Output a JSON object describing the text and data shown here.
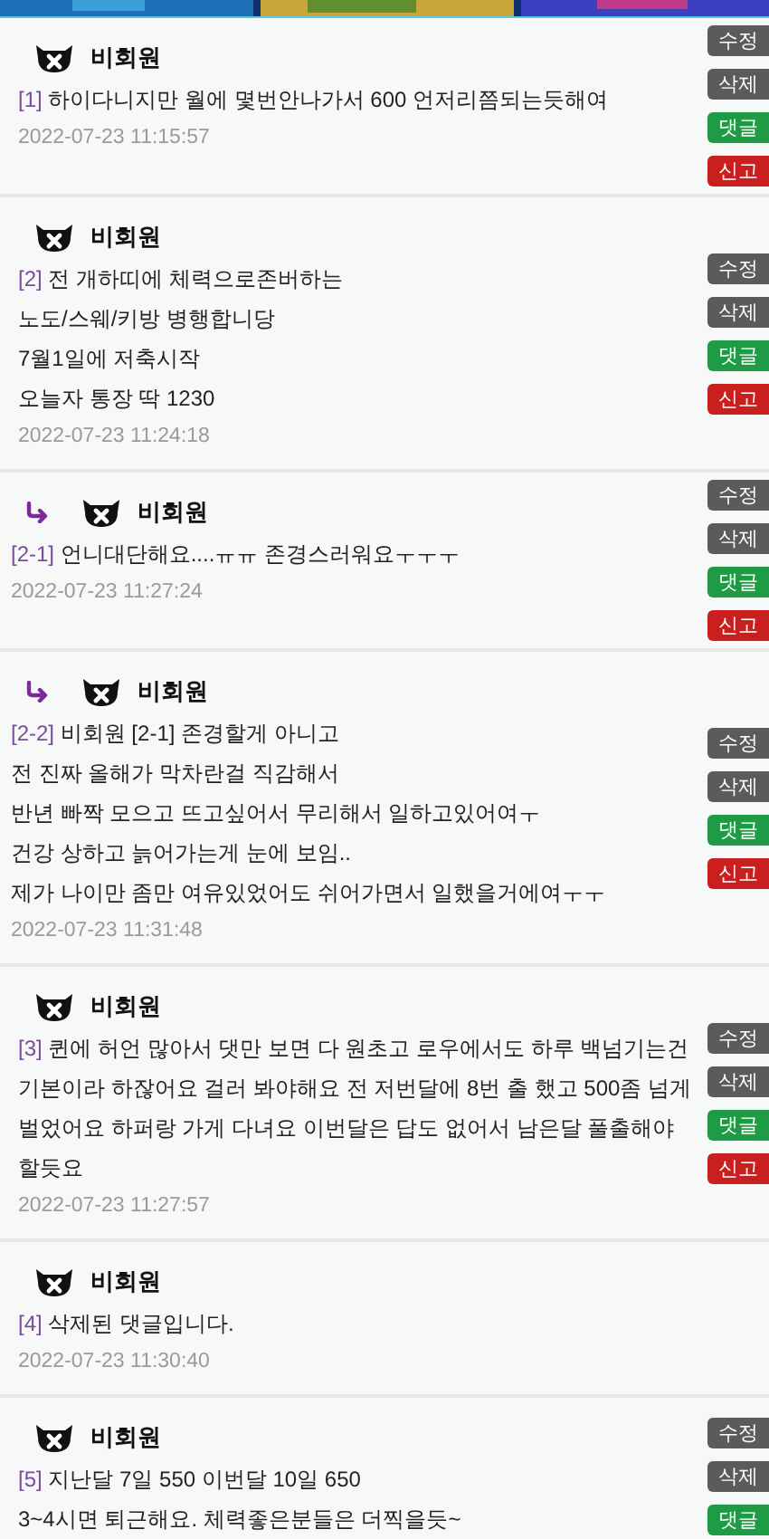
{
  "comments": [
    {
      "reply": false,
      "author": "비회원",
      "number": "[1]",
      "lines": [
        "하이다니지만 월에 몇번안나가서 600 언저리쯤되는듯해여"
      ],
      "time": "2022-07-23 11:15:57",
      "buttons": [
        {
          "label": "수정",
          "kind": "edit"
        },
        {
          "label": "삭제",
          "kind": "delete"
        },
        {
          "label": "댓글",
          "kind": "reply"
        },
        {
          "label": "신고",
          "kind": "report"
        }
      ]
    },
    {
      "reply": false,
      "author": "비회원",
      "number": "[2]",
      "lines": [
        "전 개하띠에 체력으로존버하는",
        "노도/스웨/키방 병행합니당",
        "7월1일에 저축시작",
        "오늘자 통장 딱 1230"
      ],
      "time": "2022-07-23 11:24:18",
      "buttons": [
        {
          "label": "수정",
          "kind": "edit"
        },
        {
          "label": "삭제",
          "kind": "delete"
        },
        {
          "label": "댓글",
          "kind": "reply"
        },
        {
          "label": "신고",
          "kind": "report"
        }
      ]
    },
    {
      "reply": true,
      "author": "비회원",
      "number": "[2-1]",
      "lines": [
        "언니대단해요....ㅠㅠ 존경스러워요ㅜㅜㅜ"
      ],
      "time": "2022-07-23 11:27:24",
      "buttons": [
        {
          "label": "수정",
          "kind": "edit"
        },
        {
          "label": "삭제",
          "kind": "delete"
        },
        {
          "label": "댓글",
          "kind": "reply"
        },
        {
          "label": "신고",
          "kind": "report"
        }
      ]
    },
    {
      "reply": true,
      "author": "비회원",
      "number": "[2-2]",
      "lines": [
        "비회원 [2-1]  존경할게 아니고",
        "전 진짜 올해가 막차란걸 직감해서",
        "반년 빠짝 모으고 뜨고싶어서 무리해서 일하고있어여ㅜ",
        "건강 상하고 늙어가는게 눈에 보임..",
        "제가 나이만 좀만 여유있었어도 쉬어가면서 일했을거에여ㅜㅜ"
      ],
      "time": "2022-07-23 11:31:48",
      "buttons": [
        {
          "label": "수정",
          "kind": "edit"
        },
        {
          "label": "삭제",
          "kind": "delete"
        },
        {
          "label": "댓글",
          "kind": "reply"
        },
        {
          "label": "신고",
          "kind": "report"
        }
      ]
    },
    {
      "reply": false,
      "author": "비회원",
      "number": "[3]",
      "lines": [
        "퀸에 허언 많아서 댓만 보면 다 원초고 로우에서도 하루 백넘기는건 기본이라 하잖어요 걸러 봐야해요 전 저번달에 8번 출 했고 500좀 넘게 벌었어요 하퍼랑 가게 다녀요 이번달은 답도 없어서 남은달 풀출해야 할듯요"
      ],
      "time": "2022-07-23 11:27:57",
      "buttons": [
        {
          "label": "수정",
          "kind": "edit"
        },
        {
          "label": "삭제",
          "kind": "delete"
        },
        {
          "label": "댓글",
          "kind": "reply"
        },
        {
          "label": "신고",
          "kind": "report"
        }
      ]
    },
    {
      "reply": false,
      "author": "비회원",
      "number": "[4]",
      "lines": [
        "삭제된 댓글입니다."
      ],
      "time": "2022-07-23 11:30:40"
    },
    {
      "reply": false,
      "author": "비회원",
      "number": "[5]",
      "lines": [
        "지난달 7일 550 이번달 10일 650",
        "3~4시면 퇴근해요. 체력좋은분들은 더찍을듯~"
      ],
      "buttons": [
        {
          "label": "수정",
          "kind": "edit"
        },
        {
          "label": "삭제",
          "kind": "delete"
        },
        {
          "label": "댓글",
          "kind": "reply"
        }
      ]
    }
  ]
}
